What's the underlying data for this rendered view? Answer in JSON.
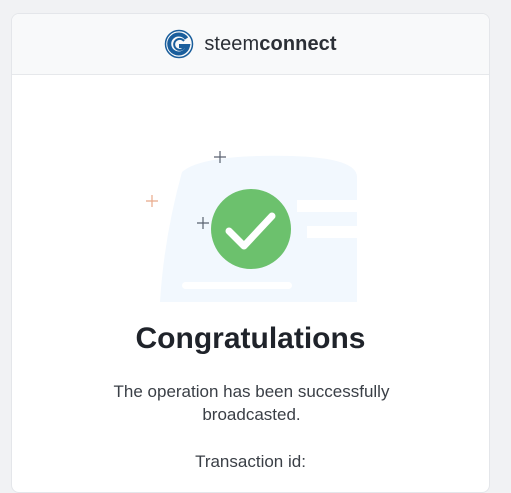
{
  "header": {
    "brand_prefix": "steem",
    "brand_suffix": "connect",
    "logo_icon": "steemconnect-logo-icon"
  },
  "success": {
    "icon": "checkmark-circle-icon",
    "title": "Congratulations",
    "message": "The operation has been successfully broadcasted.",
    "transaction_label": "Transaction id:"
  },
  "colors": {
    "brand_blue": "#1a5e9c",
    "success_green": "#6cc16d",
    "page_background": "#f1f2f4"
  }
}
